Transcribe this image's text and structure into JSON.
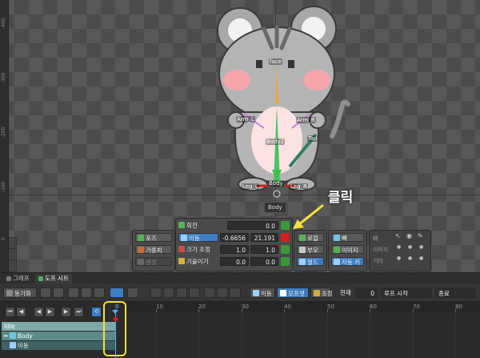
{
  "viewport": {
    "ruler_ticks": [
      "0",
      "-100",
      "-200",
      "-300",
      "-400"
    ],
    "bones": {
      "face": "face",
      "arm_l": "Arm_L",
      "arm_r": "Arm_R",
      "body2": "Body2",
      "tail": "Tail",
      "leg_l": "Leg_L",
      "leg_r": "Leg_R",
      "body": "Body"
    },
    "tooltip": "Body",
    "annotation": "클릭"
  },
  "pose_panel": {
    "pose": "포즈",
    "weights": "가중치",
    "create": "생성"
  },
  "transform_panel": {
    "rotate_label": "회전",
    "rotate_value": "0.0",
    "translate_label": "이동",
    "translate_x": "-0.6656",
    "translate_y": "21.191",
    "scale_label": "크기 조정",
    "scale_x": "1.0",
    "scale_y": "1.0",
    "shear_label": "기울이기",
    "shear_x": "0.0",
    "shear_y": "0.0"
  },
  "axis_panel": {
    "local": "로컬",
    "parent": "부모",
    "world": "월드"
  },
  "bone_panel": {
    "bone": "뼈",
    "image": "이미지",
    "autokey": "자동 키"
  },
  "visibility_panel": {
    "bone": "뼈",
    "image": "이미지",
    "other": "기타"
  },
  "tabs": {
    "graph": "그래프",
    "dopesheet": "도프 시트"
  },
  "toolbar": {
    "sync": "동기화",
    "move": "이동",
    "offset": "오프셋",
    "adjust": "조정",
    "current_label": "현재",
    "current_value": "0",
    "loop_start": "루프 시작",
    "end": "종료"
  },
  "timeline": {
    "frame_labels": [
      "0",
      "10",
      "20",
      "30",
      "40",
      "50",
      "60",
      "70",
      "80"
    ],
    "rows": {
      "animation": "Idle",
      "bone": "Body",
      "channel": "이동"
    }
  },
  "colors": {
    "accent": "#3d7ec4",
    "key_green": "#3a9a3a",
    "key_red": "#d02020",
    "highlight": "#f4e23c"
  }
}
